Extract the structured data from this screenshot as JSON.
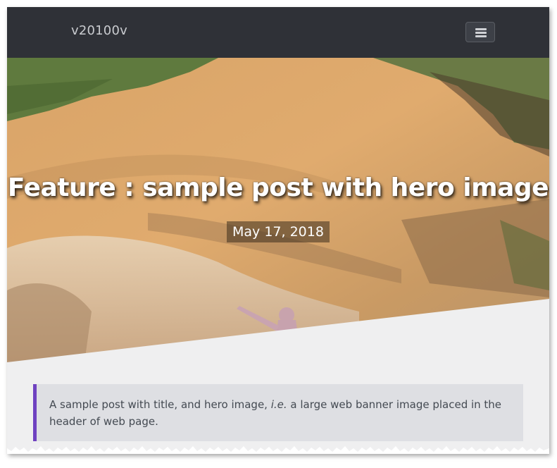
{
  "navbar": {
    "brand": "v20100v",
    "menu_icon": "hamburger-icon"
  },
  "hero": {
    "title": "Feature : sample post with hero image",
    "date": "May 17, 2018"
  },
  "excerpt": {
    "text_before": "A sample post with title, and hero image, ",
    "emphasis": "i.e.",
    "text_after": " a large web banner image placed in the header of web page."
  },
  "colors": {
    "navbar": "#2f3137",
    "accent": "#6f42c1",
    "page_bg": "#efeff0",
    "excerpt_bg": "#dedfe3"
  }
}
